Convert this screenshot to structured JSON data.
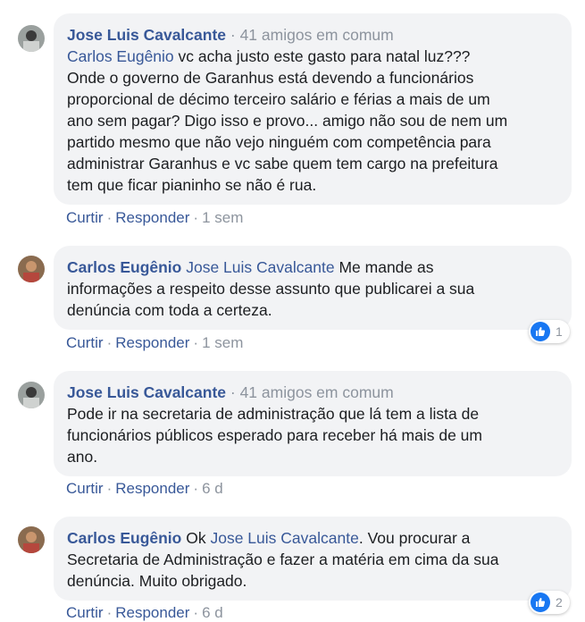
{
  "comments": [
    {
      "author": "Jose Luis Cavalcante",
      "mutual": "41 amigos em comum",
      "mention": "Carlos Eugênio",
      "text": "vc acha justo este gasto para natal luz???",
      "body_lines": [
        "Onde o governo de Garanhus está devendo a funcionários",
        "proporcional de décimo terceiro salário e férias a mais de um",
        "ano sem pagar? Digo isso e provo... amigo não sou de nem um",
        "partido mesmo que não vejo ninguém com competência para",
        "administrar Garanhus e vc sabe quem tem cargo na prefeitura",
        "tem que ficar pianinho se não é rua."
      ],
      "like": "Curtir",
      "reply": "Responder",
      "time": "1 sem"
    },
    {
      "author": "Carlos Eugênio",
      "mention": "Jose Luis Cavalcante",
      "text": "Me mande as",
      "body_lines": [
        "informações a respeito desse assunto que publicarei a sua",
        "denúncia com toda a certeza."
      ],
      "like": "Curtir",
      "reply": "Responder",
      "time": "1 sem",
      "reaction_count": "1"
    },
    {
      "author": "Jose Luis Cavalcante",
      "mutual": "41 amigos em comum",
      "body_lines": [
        "Pode ir na secretaria de administração que lá tem a lista de",
        "funcionários públicos esperado para receber há mais de um",
        "ano."
      ],
      "like": "Curtir",
      "reply": "Responder",
      "time": "6 d"
    },
    {
      "author": "Carlos Eugênio",
      "pre": "Ok",
      "mention": "Jose Luis Cavalcante",
      "text": ". Vou procurar a",
      "body_lines": [
        "Secretaria de Administração e fazer a matéria em cima da sua",
        "denúncia. Muito obrigado."
      ],
      "like": "Curtir",
      "reply": "Responder",
      "time": "6 d",
      "reaction_count": "2"
    }
  ],
  "separator_dot": "·",
  "icons": {
    "like": "thumbs-up-icon"
  },
  "colors": {
    "name": "#385898",
    "bubble": "#f2f3f5",
    "like_blue": "#1877f2"
  }
}
